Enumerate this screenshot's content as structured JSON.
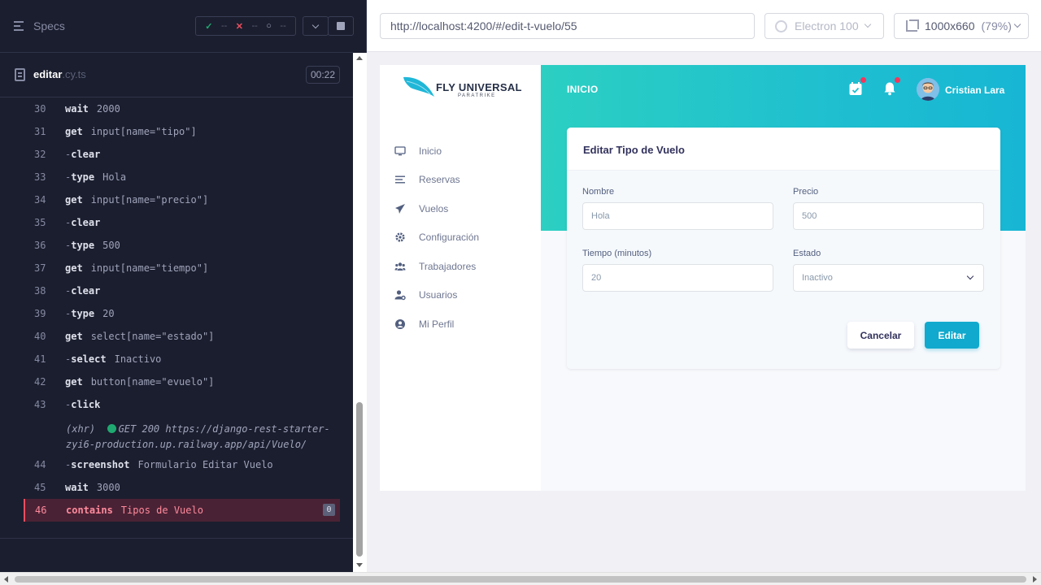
{
  "reporter": {
    "specs_label": "Specs",
    "stats": {
      "passed": "--",
      "failed": "--",
      "pending": "--"
    },
    "spec_file": {
      "name": "editar",
      "ext": ".cy.ts"
    },
    "duration": "00:22",
    "commands": [
      {
        "num": "30",
        "name": "wait",
        "child": false,
        "msg": "2000"
      },
      {
        "num": "31",
        "name": "get",
        "child": false,
        "msg": "input[name=\"tipo\"]"
      },
      {
        "num": "32",
        "name": "clear",
        "child": true,
        "msg": ""
      },
      {
        "num": "33",
        "name": "type",
        "child": true,
        "msg": "Hola"
      },
      {
        "num": "34",
        "name": "get",
        "child": false,
        "msg": "input[name=\"precio\"]"
      },
      {
        "num": "35",
        "name": "clear",
        "child": true,
        "msg": ""
      },
      {
        "num": "36",
        "name": "type",
        "child": true,
        "msg": "500"
      },
      {
        "num": "37",
        "name": "get",
        "child": false,
        "msg": "input[name=\"tiempo\"]"
      },
      {
        "num": "38",
        "name": "clear",
        "child": true,
        "msg": ""
      },
      {
        "num": "39",
        "name": "type",
        "child": true,
        "msg": "20"
      },
      {
        "num": "40",
        "name": "get",
        "child": false,
        "msg": "select[name=\"estado\"]"
      },
      {
        "num": "41",
        "name": "select",
        "child": true,
        "msg": "Inactivo"
      },
      {
        "num": "42",
        "name": "get",
        "child": false,
        "msg": "button[name=\"evuelo\"]"
      },
      {
        "num": "43",
        "name": "click",
        "child": true,
        "msg": ""
      }
    ],
    "xhr": {
      "type": "(xhr)",
      "line1": "GET 200 https://django-rest-starter-",
      "line2": "zyi6-production.up.railway.app/api/Vuelo/"
    },
    "commands_after": [
      {
        "num": "44",
        "name": "screenshot",
        "child": true,
        "msg": "Formulario Editar Vuelo"
      },
      {
        "num": "45",
        "name": "wait",
        "child": false,
        "msg": "3000"
      }
    ],
    "failed_command": {
      "num": "46",
      "name": "contains",
      "msg": "Tipos de Vuelo",
      "count": "0"
    }
  },
  "aut_bar": {
    "url": "http://localhost:4200/#/edit-t-vuelo/55",
    "browser": "Electron 100",
    "viewport_size": "1000x660",
    "zoom": "(79%)"
  },
  "app": {
    "logo": {
      "title": "FLY UNIVERSAL",
      "subtitle": "PARATRIKE"
    },
    "nav": [
      {
        "label": "Inicio",
        "icon": "monitor-icon"
      },
      {
        "label": "Reservas",
        "icon": "list-icon"
      },
      {
        "label": "Vuelos",
        "icon": "paper-plane-icon"
      },
      {
        "label": "Configuración",
        "icon": "gear-icon"
      },
      {
        "label": "Trabajadores",
        "icon": "users-icon"
      },
      {
        "label": "Usuarios",
        "icon": "user-cog-icon"
      },
      {
        "label": "Mi Perfil",
        "icon": "user-circle-icon"
      }
    ],
    "header": {
      "title": "INICIO",
      "user_name": "Cristian Lara"
    },
    "form": {
      "title": "Editar Tipo de Vuelo",
      "nombre_label": "Nombre",
      "nombre_value": "Hola",
      "precio_label": "Precio",
      "precio_value": "500",
      "tiempo_label": "Tiempo (minutos)",
      "tiempo_value": "20",
      "estado_label": "Estado",
      "estado_value": "Inactivo",
      "cancel_label": "Cancelar",
      "submit_label": "Editar"
    }
  },
  "colors": {
    "reporter_bg": "#1b1e2e",
    "header_gradient_start": "#2ccfc2",
    "header_gradient_end": "#17b6d4",
    "primary_button": "#11a9cd",
    "failed_row": "#4a2235",
    "notification_dot": "#f5365c"
  }
}
